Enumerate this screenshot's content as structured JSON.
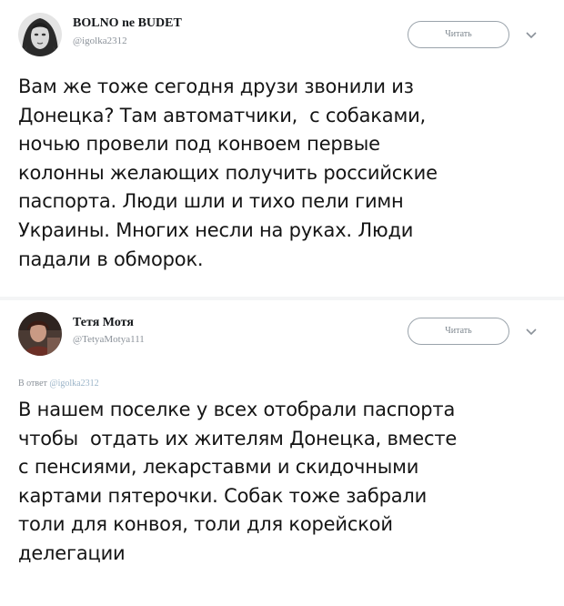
{
  "tweets": [
    {
      "author_name": "BOLNO ne BUDET",
      "author_handle": "@igolka2312",
      "avatar_icon": "portrait-avatar",
      "follow_label": "Читать",
      "caret_icon": "chevron-down-icon",
      "text": "Вам же тоже сегодня друзи звонили из\nДонецка? Там автоматчики,  с собаками,\nночью провели под конвоем первые\nколонны желающих получить российские\nпаспорта. Люди шли и тихо пели гимн\nУкраины. Многих несли на руках. Люди\nпадали в обморок."
    },
    {
      "author_name": "Тетя Мотя",
      "author_handle": "@TetyaMotya111",
      "avatar_icon": "photo-avatar",
      "follow_label": "Читать",
      "caret_icon": "chevron-down-icon",
      "reply_prefix": "В ответ",
      "reply_mention": "@igolka2312",
      "text": "В нашем поселке у всех отобрали паспорта\nчтобы  отдать их жителям Донецка, вместе\nс пенсиями, лекарставми и скидочными\nкартами пятерочки. Собак тоже забрали\nтоли для конвоя, толи для корейской\nделегации"
    }
  ],
  "colors": {
    "text": "#151515",
    "secondary": "#8a9199",
    "button_border": "#9aa3ab",
    "mention": "#9bb4c8"
  }
}
